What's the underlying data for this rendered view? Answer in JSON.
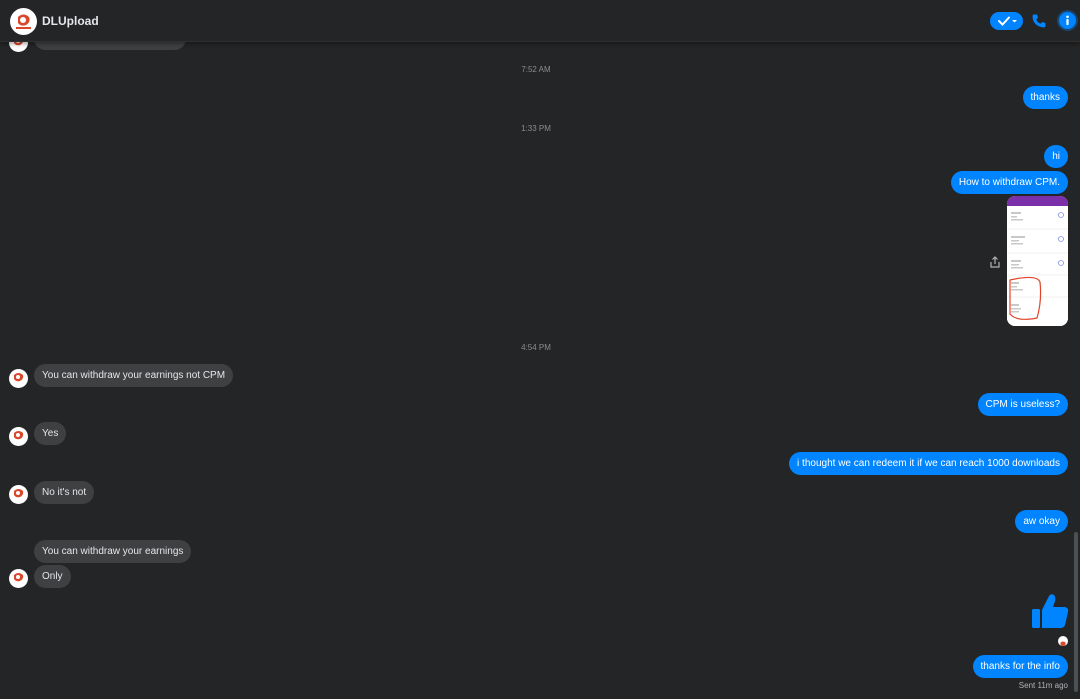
{
  "header": {
    "title": "DLUpload",
    "accent": "#0084ff"
  },
  "timestamps": [
    "7:52 AM",
    "1:33 PM",
    "4:54 PM"
  ],
  "messages": {
    "out_thanks": "thanks",
    "out_hi": "hi",
    "out_how": "How to withdraw CPM.",
    "in_withdraw": "You can withdraw your earnings not CPM",
    "out_useless": "CPM is useless?",
    "in_yes": "Yes",
    "out_thought": "i thought we can redeem it if we can reach 1000 downloads",
    "in_no": "No it's not",
    "out_aw": "aw okay",
    "in_withdraw2": "You can withdraw your earnings",
    "in_only": "Only",
    "out_info": "thanks for the info"
  },
  "status": {
    "sent": "Sent 11m ago"
  },
  "icons": [
    "check-icon",
    "phone-icon",
    "info-icon",
    "share-icon",
    "thumbs-up-icon"
  ],
  "colors": {
    "background": "#242526",
    "incoming": "#3e4042",
    "outgoing": "#0084ff"
  }
}
